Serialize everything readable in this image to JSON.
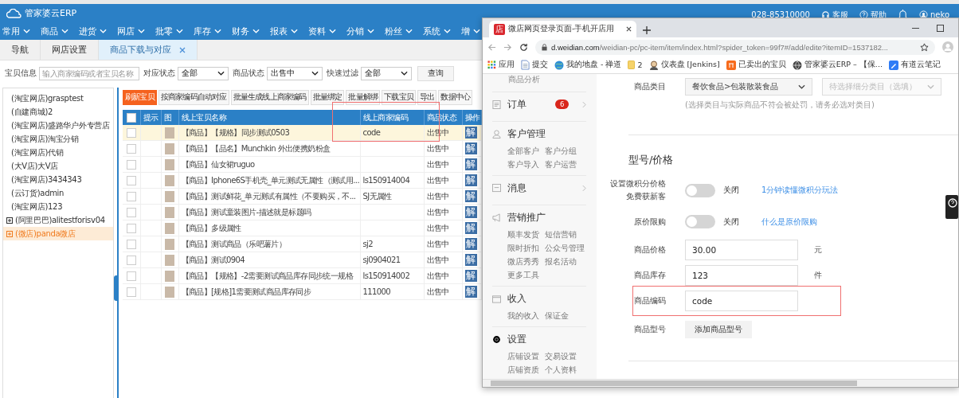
{
  "erp": {
    "logo": "管家婆云ERP",
    "header_links": [
      {
        "kind": "phone",
        "label": "028-85310000"
      },
      {
        "kind": "service",
        "label": "客服"
      },
      {
        "kind": "help",
        "label": "帮助"
      },
      {
        "kind": "bell"
      },
      {
        "kind": "user",
        "label": "neko"
      }
    ],
    "menu": [
      "常用",
      "商品",
      "进货",
      "网店",
      "批零",
      "库存",
      "财务",
      "报表",
      "资料",
      "分销",
      "粉丝",
      "系统",
      "增"
    ],
    "tabs": [
      {
        "label": "导航",
        "selected": false,
        "closable": false
      },
      {
        "label": "网店设置",
        "selected": false,
        "closable": false
      },
      {
        "label": "商品下载与对应",
        "selected": true,
        "closable": true
      }
    ],
    "filters": [
      {
        "label": "宝贝信息",
        "kind": "text",
        "placeholder": "输入商家编码或者宝贝名称"
      },
      {
        "label": "对应状态",
        "kind": "select",
        "value": "全部"
      },
      {
        "label": "商品状态",
        "kind": "select",
        "value": "出售中"
      },
      {
        "label": "快速过滤",
        "kind": "select",
        "value": "全部"
      }
    ],
    "query_button": "查询",
    "stores": [
      {
        "label": "(淘宝网店)grasptest",
        "selected": false,
        "expandable": false
      },
      {
        "label": "(自建商城)2",
        "selected": false,
        "expandable": false
      },
      {
        "label": "(淘宝网店)盛路华户外专营店",
        "selected": false,
        "expandable": false
      },
      {
        "label": "(淘宝网店)淘宝分销",
        "selected": false,
        "expandable": false
      },
      {
        "label": "(淘宝网店)代销",
        "selected": false,
        "expandable": false
      },
      {
        "label": "(大V店)大V店",
        "selected": false,
        "expandable": false
      },
      {
        "label": "(淘宝网店)3434343",
        "selected": false,
        "expandable": false
      },
      {
        "label": "(云订货)admin",
        "selected": false,
        "expandable": false
      },
      {
        "label": "(淘宝网店)123",
        "selected": false,
        "expandable": false
      },
      {
        "label": "(阿里巴巴)alitestforisv04",
        "selected": false,
        "expandable": true
      },
      {
        "label": "(微店)panda微店",
        "selected": true,
        "expandable": true
      }
    ],
    "toolbar": [
      {
        "label": "刷新宝贝",
        "primary": true
      },
      {
        "label": "按商家编码自动对应",
        "primary": false
      },
      {
        "label": "批量生成线上商家编码",
        "primary": false
      },
      {
        "label": "批量绑定",
        "primary": false
      },
      {
        "label": "批量解绑",
        "primary": false
      },
      {
        "label": "下载宝贝",
        "primary": false
      },
      {
        "label": "导出",
        "primary": false
      },
      {
        "label": "数据中心",
        "primary": false
      }
    ],
    "table": {
      "all_checked": false,
      "columns": [
        "提示",
        "图",
        "线上宝贝名称",
        "线上商家编码",
        "商品状态",
        "操作"
      ],
      "rows": [
        {
          "selected": true,
          "checked": false,
          "name": "【商品】【规格】同步测试0503",
          "code": "code",
          "status": "出售中",
          "action": "解"
        },
        {
          "selected": false,
          "checked": false,
          "name": "【商品】【品名】Munchkin 外出便携奶粉盒",
          "status": "出售中",
          "action": "解"
        },
        {
          "selected": false,
          "checked": false,
          "name": "【商品】仙女裙ruguo",
          "status": "出售中",
          "action": "解"
        },
        {
          "selected": false,
          "checked": false,
          "name": "【商品】Iphone6S手机壳_单元测试无属性（测试用...",
          "code": "ls150914004",
          "status": "出售中",
          "action": "解"
        },
        {
          "selected": false,
          "checked": false,
          "name": "【商品】测试鲜花_单元测试有属性（不要购买，不...",
          "code": "SJ无属性",
          "status": "出售中",
          "action": "解"
        },
        {
          "selected": false,
          "checked": false,
          "name": "【商品】测试童装图片-描述就是标题吗",
          "status": "出售中",
          "action": "解"
        },
        {
          "selected": false,
          "checked": false,
          "name": "【商品】多级属性",
          "status": "出售中",
          "action": "解"
        },
        {
          "selected": false,
          "checked": false,
          "name": "【商品】测试商品（乐吧薯片）",
          "code": "sj2",
          "status": "出售中",
          "action": "解"
        },
        {
          "selected": false,
          "checked": false,
          "name": "【商品】测试0904",
          "code": "sj0904021",
          "status": "出售中",
          "action": "解"
        },
        {
          "selected": false,
          "checked": false,
          "name": "【商品】【规格】-2需要测试商品库存同步统一规格",
          "code": "ls150914002",
          "status": "出售中",
          "action": "解"
        },
        {
          "selected": false,
          "checked": false,
          "name": "【商品】[规格]1需要测试商品库存同步",
          "code": "111000",
          "status": "出售中",
          "action": "解"
        }
      ]
    }
  },
  "browser": {
    "tab": {
      "favicon": "店",
      "title": "微店网页登录页面-手机开店用"
    },
    "url_host": "d.weidian.com",
    "url_path": "/weidian-pc/pc-item/item/index.html?spider_token=99f7#/add/edite?itemID=1537182...",
    "bookmarks": [
      {
        "kind": "apps",
        "label": "应用"
      },
      {
        "kind": "doc",
        "label": "提交"
      },
      {
        "kind": "globe",
        "label": "我的地盘 - 禅道"
      },
      {
        "kind": "folder",
        "label": "2"
      },
      {
        "kind": "avatar",
        "label": "仪表盘 [Jenkins]"
      },
      {
        "kind": "shop",
        "label": "已卖出的宝贝"
      },
      {
        "kind": "world",
        "label": "管家婆云ERP – 【保..."
      },
      {
        "kind": "note",
        "label": "有道云笔记"
      }
    ],
    "sidebar_top": "商品分析",
    "sidebar": [
      {
        "title": "订单",
        "badge": "6",
        "has_arrow": true
      },
      {
        "title": "客户管理",
        "has_arrow": false,
        "links": [
          "全部客户",
          "客户分组",
          "客户导入",
          "客户运营"
        ]
      },
      {
        "title": "消息",
        "has_arrow": true
      },
      {
        "title": "营销推广",
        "has_arrow": false,
        "links": [
          "顺丰发货",
          "短信营销",
          "限时折扣",
          "公众号管理",
          "微店秀秀",
          "报名活动",
          "更多工具"
        ]
      },
      {
        "title": "收入",
        "has_arrow": false,
        "links": [
          "我的收入",
          "保证金"
        ]
      },
      {
        "title": "设置",
        "has_arrow": false,
        "links": [
          "店铺设置",
          "交易设置",
          "店铺资质",
          "个人资料"
        ]
      }
    ],
    "category": {
      "label": "商品类目",
      "value": "餐饮食品>包装散装食品",
      "sub_placeholder": "待选择细分类目（选填）",
      "hint": "(选择类目与实际商品不符会被处罚，请务必选对类目)"
    },
    "section_title": "型号/价格",
    "toggles": [
      {
        "label_lines": [
          "设置微积分价格",
          "免费获新客"
        ],
        "on": false,
        "state_text": "关闭",
        "link": "1分钟读懂微积分玩法"
      },
      {
        "label_lines": [
          "原价限购"
        ],
        "on": false,
        "state_text": "关闭",
        "link": "什么是原价限购"
      }
    ],
    "fields": [
      {
        "label": "商品价格",
        "value": "30.00",
        "unit": "元",
        "highlighted": false
      },
      {
        "label": "商品库存",
        "value": "123",
        "unit": "件",
        "highlighted": false
      },
      {
        "label": "商品编码",
        "value": "code",
        "highlighted": true
      }
    ],
    "model": {
      "label": "商品型号",
      "button": "添加商品型号"
    }
  }
}
